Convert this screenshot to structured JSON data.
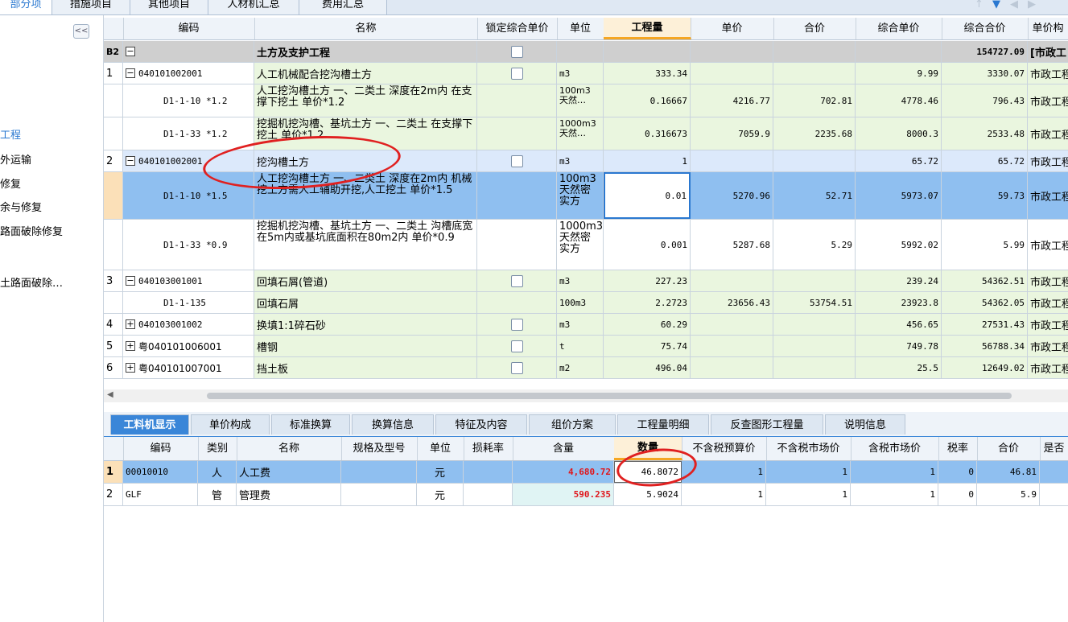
{
  "top_tabs": [
    {
      "label": "部分项",
      "active": true
    },
    {
      "label": "措施项目",
      "active": false
    },
    {
      "label": "其他项目",
      "active": false
    },
    {
      "label": "人材机汇总",
      "active": false
    },
    {
      "label": "费用汇总",
      "active": false
    }
  ],
  "nav_icons": [
    "arrow-up-icon",
    "arrow-down-icon",
    "arrow-left-icon",
    "arrow-right-icon"
  ],
  "sidebar": {
    "collapse_label": "<<",
    "items": [
      {
        "label": "工程",
        "selected": true
      },
      {
        "label": "外运输",
        "selected": false
      },
      {
        "label": "修复",
        "selected": false
      },
      {
        "label": "余与修复",
        "selected": false
      },
      {
        "label": "路面破除修复",
        "selected": false
      },
      {
        "label": "土路面破除…",
        "selected": false
      }
    ]
  },
  "grid": {
    "columns": [
      "编码",
      "名称",
      "锁定综合单价",
      "单位",
      "工程量",
      "单价",
      "合价",
      "综合单价",
      "综合合价",
      "单价构"
    ],
    "rows": [
      {
        "kind": "section",
        "num": "B2",
        "toggle": "−",
        "code": "",
        "name": "土方及支护工程",
        "unit": "",
        "qty": "",
        "price": "",
        "total": "",
        "unit_price": "",
        "total_price": "154727.09",
        "extra": "[市政工"
      },
      {
        "kind": "item",
        "num": "1",
        "toggle": "−",
        "code": "040101002001",
        "name": "人工机械配合挖沟槽土方",
        "unit": "m3",
        "qty": "333.34",
        "price": "",
        "total": "",
        "unit_price": "9.99",
        "total_price": "3330.07",
        "extra": "市政工程"
      },
      {
        "kind": "sub",
        "code": "D1-1-10 *1.2",
        "name": "人工挖沟槽土方 一、二类土 深度在2m内 在支撑下挖土 单价*1.2",
        "unit": "100m3 天然…",
        "qty": "0.16667",
        "price": "4216.77",
        "total": "702.81",
        "unit_price": "4778.46",
        "total_price": "796.43",
        "extra": "市政工程"
      },
      {
        "kind": "sub",
        "code": "D1-1-33 *1.2",
        "name": "挖掘机挖沟槽、基坑土方 一、二类土 在支撑下挖土 单价*1.2",
        "unit": "1000m3 天然…",
        "qty": "0.316673",
        "price": "7059.9",
        "total": "2235.68",
        "unit_price": "8000.3",
        "total_price": "2533.48",
        "extra": "市政工程"
      },
      {
        "kind": "item-sel",
        "num": "2",
        "toggle": "−",
        "code": "040101002001",
        "name": "挖沟槽土方",
        "unit": "m3",
        "qty": "1",
        "price": "",
        "total": "",
        "unit_price": "65.72",
        "total_price": "65.72",
        "extra": "市政工程"
      },
      {
        "kind": "sub-active",
        "code": "D1-1-10 *1.5",
        "name": "人工挖沟槽土方 一、二类土 深度在2m内 机械挖土方需人工辅助开挖,人工挖土 单价*1.5",
        "unit": "100m3 天然密 实方",
        "qty": "0.01",
        "price": "5270.96",
        "total": "52.71",
        "unit_price": "5973.07",
        "total_price": "59.73",
        "extra": "市政工程"
      },
      {
        "kind": "sub-white",
        "code": "D1-1-33 *0.9",
        "name": "挖掘机挖沟槽、基坑土方 一、二类土 沟槽底宽在5m内或基坑底面积在80m2内 单价*0.9",
        "unit": "1000m3 天然密 实方",
        "qty": "0.001",
        "price": "5287.68",
        "total": "5.29",
        "unit_price": "5992.02",
        "total_price": "5.99",
        "extra": "市政工程"
      },
      {
        "kind": "item",
        "num": "3",
        "toggle": "−",
        "code": "040103001001",
        "name": "回填石屑(管道)",
        "unit": "m3",
        "qty": "227.23",
        "price": "",
        "total": "",
        "unit_price": "239.24",
        "total_price": "54362.51",
        "extra": "市政工程"
      },
      {
        "kind": "sub",
        "code": "D1-1-135",
        "name": "回填石屑",
        "unit": "100m3",
        "qty": "2.2723",
        "price": "23656.43",
        "total": "53754.51",
        "unit_price": "23923.8",
        "total_price": "54362.05",
        "extra": "市政工程"
      },
      {
        "kind": "item",
        "num": "4",
        "toggle": "+",
        "code": "040103001002",
        "name": "换填1:1碎石砂",
        "unit": "m3",
        "qty": "60.29",
        "price": "",
        "total": "",
        "unit_price": "456.65",
        "total_price": "27531.43",
        "extra": "市政工程"
      },
      {
        "kind": "item",
        "num": "5",
        "toggle": "+",
        "code": "粤040101006001",
        "name": "槽钢",
        "unit": "t",
        "qty": "75.74",
        "price": "",
        "total": "",
        "unit_price": "749.78",
        "total_price": "56788.34",
        "extra": "市政工程"
      },
      {
        "kind": "item",
        "num": "6",
        "toggle": "+",
        "code": "粤040101007001",
        "name": "挡土板",
        "unit": "m2",
        "qty": "496.04",
        "price": "",
        "total": "",
        "unit_price": "25.5",
        "total_price": "12649.02",
        "extra": "市政工程"
      }
    ]
  },
  "bottom_tabs": [
    {
      "label": "工料机显示",
      "active": true
    },
    {
      "label": "单价构成",
      "active": false
    },
    {
      "label": "标准换算",
      "active": false
    },
    {
      "label": "换算信息",
      "active": false
    },
    {
      "label": "特征及内容",
      "active": false
    },
    {
      "label": "组价方案",
      "active": false
    },
    {
      "label": "工程量明细",
      "active": false
    },
    {
      "label": "反查图形工程量",
      "active": false
    },
    {
      "label": "说明信息",
      "active": false
    }
  ],
  "resource_grid": {
    "columns": [
      "编码",
      "类别",
      "名称",
      "规格及型号",
      "单位",
      "损耗率",
      "含量",
      "数量",
      "不含税预算价",
      "不含税市场价",
      "含税市场价",
      "税率",
      "合价",
      "是否"
    ],
    "rows": [
      {
        "num": "1",
        "code": "00010010",
        "category": "人",
        "name": "人工费",
        "spec": "",
        "unit": "元",
        "loss": "",
        "content": "4,680.72",
        "quantity": "46.8072",
        "pre_tax_budget": "1",
        "pre_tax_market": "1",
        "tax_market": "1",
        "tax_rate": "0",
        "total": "46.81"
      },
      {
        "num": "2",
        "code": "GLF",
        "category": "管",
        "name": "管理费",
        "spec": "",
        "unit": "元",
        "loss": "",
        "content": "590.235",
        "quantity": "5.9024",
        "pre_tax_budget": "1",
        "pre_tax_market": "1",
        "tax_market": "1",
        "tax_rate": "0",
        "total": "5.9"
      }
    ]
  },
  "colors": {
    "row_green": "#eaf6df",
    "row_selected": "#dce9fb",
    "row_active": "#8fbff0",
    "section_gray": "#cfcfcf",
    "accent": "#3a86d8",
    "highlight_header": "#f5a623",
    "annotation_red": "#e02020"
  }
}
